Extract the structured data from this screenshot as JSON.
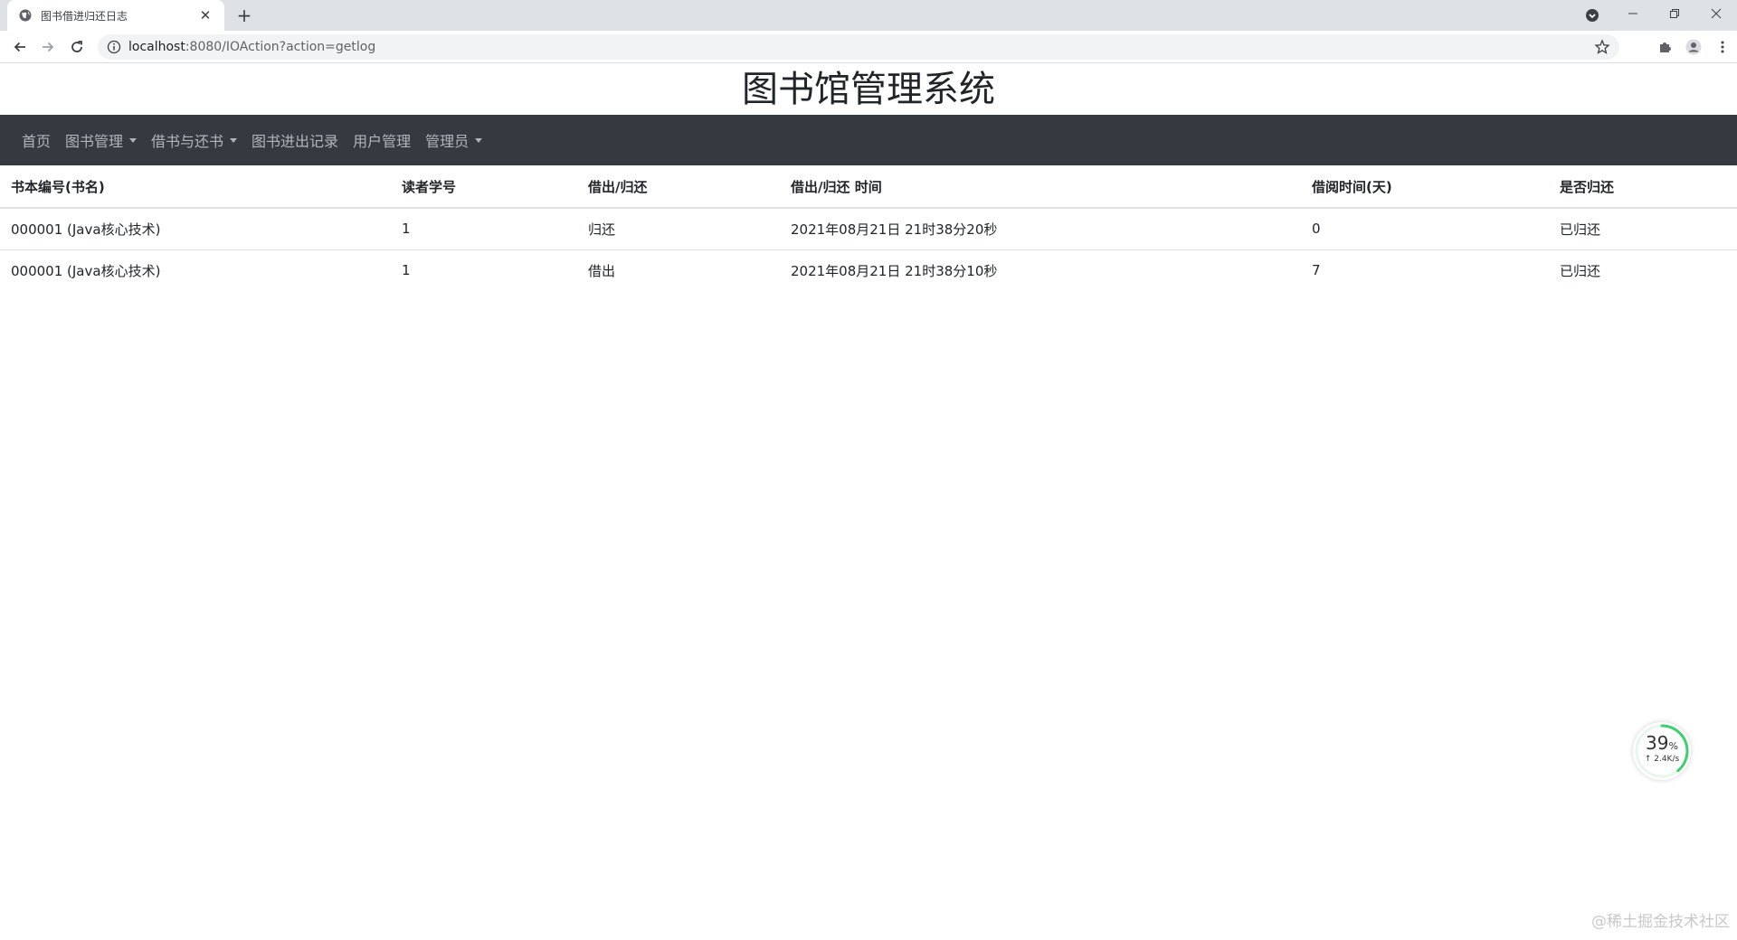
{
  "browser": {
    "tab_title": "图书借进归还日志",
    "url_host": "localhost",
    "url_path": ":8080/IOAction?action=getlog"
  },
  "page": {
    "site_title": "图书馆管理系统",
    "nav": {
      "home": "首页",
      "book_mgmt": "图书管理",
      "borrow_return": "借书与还书",
      "io_records": "图书进出记录",
      "user_mgmt": "用户管理",
      "admin": "管理员"
    },
    "table": {
      "headers": [
        "书本编号(书名)",
        "读者学号",
        "借出/归还",
        "借出/归还 时间",
        "借阅时间(天)",
        "是否归还"
      ],
      "rows": [
        [
          "000001 (Java核心技术)",
          "1",
          "归还",
          "2021年08月21日 21时38分20秒",
          "0",
          "已归还"
        ],
        [
          "000001 (Java核心技术)",
          "1",
          "借出",
          "2021年08月21日 21时38分10秒",
          "7",
          "已归还"
        ]
      ]
    }
  },
  "net_widget": {
    "percent": "39",
    "percent_unit": "%",
    "percent_value": 39,
    "speed": "↑ 2.4K/s"
  },
  "watermark": "@稀土掘金技术社区",
  "colors": {
    "navbar_bg": "#343a40",
    "ring_green": "#3ecf6e"
  }
}
